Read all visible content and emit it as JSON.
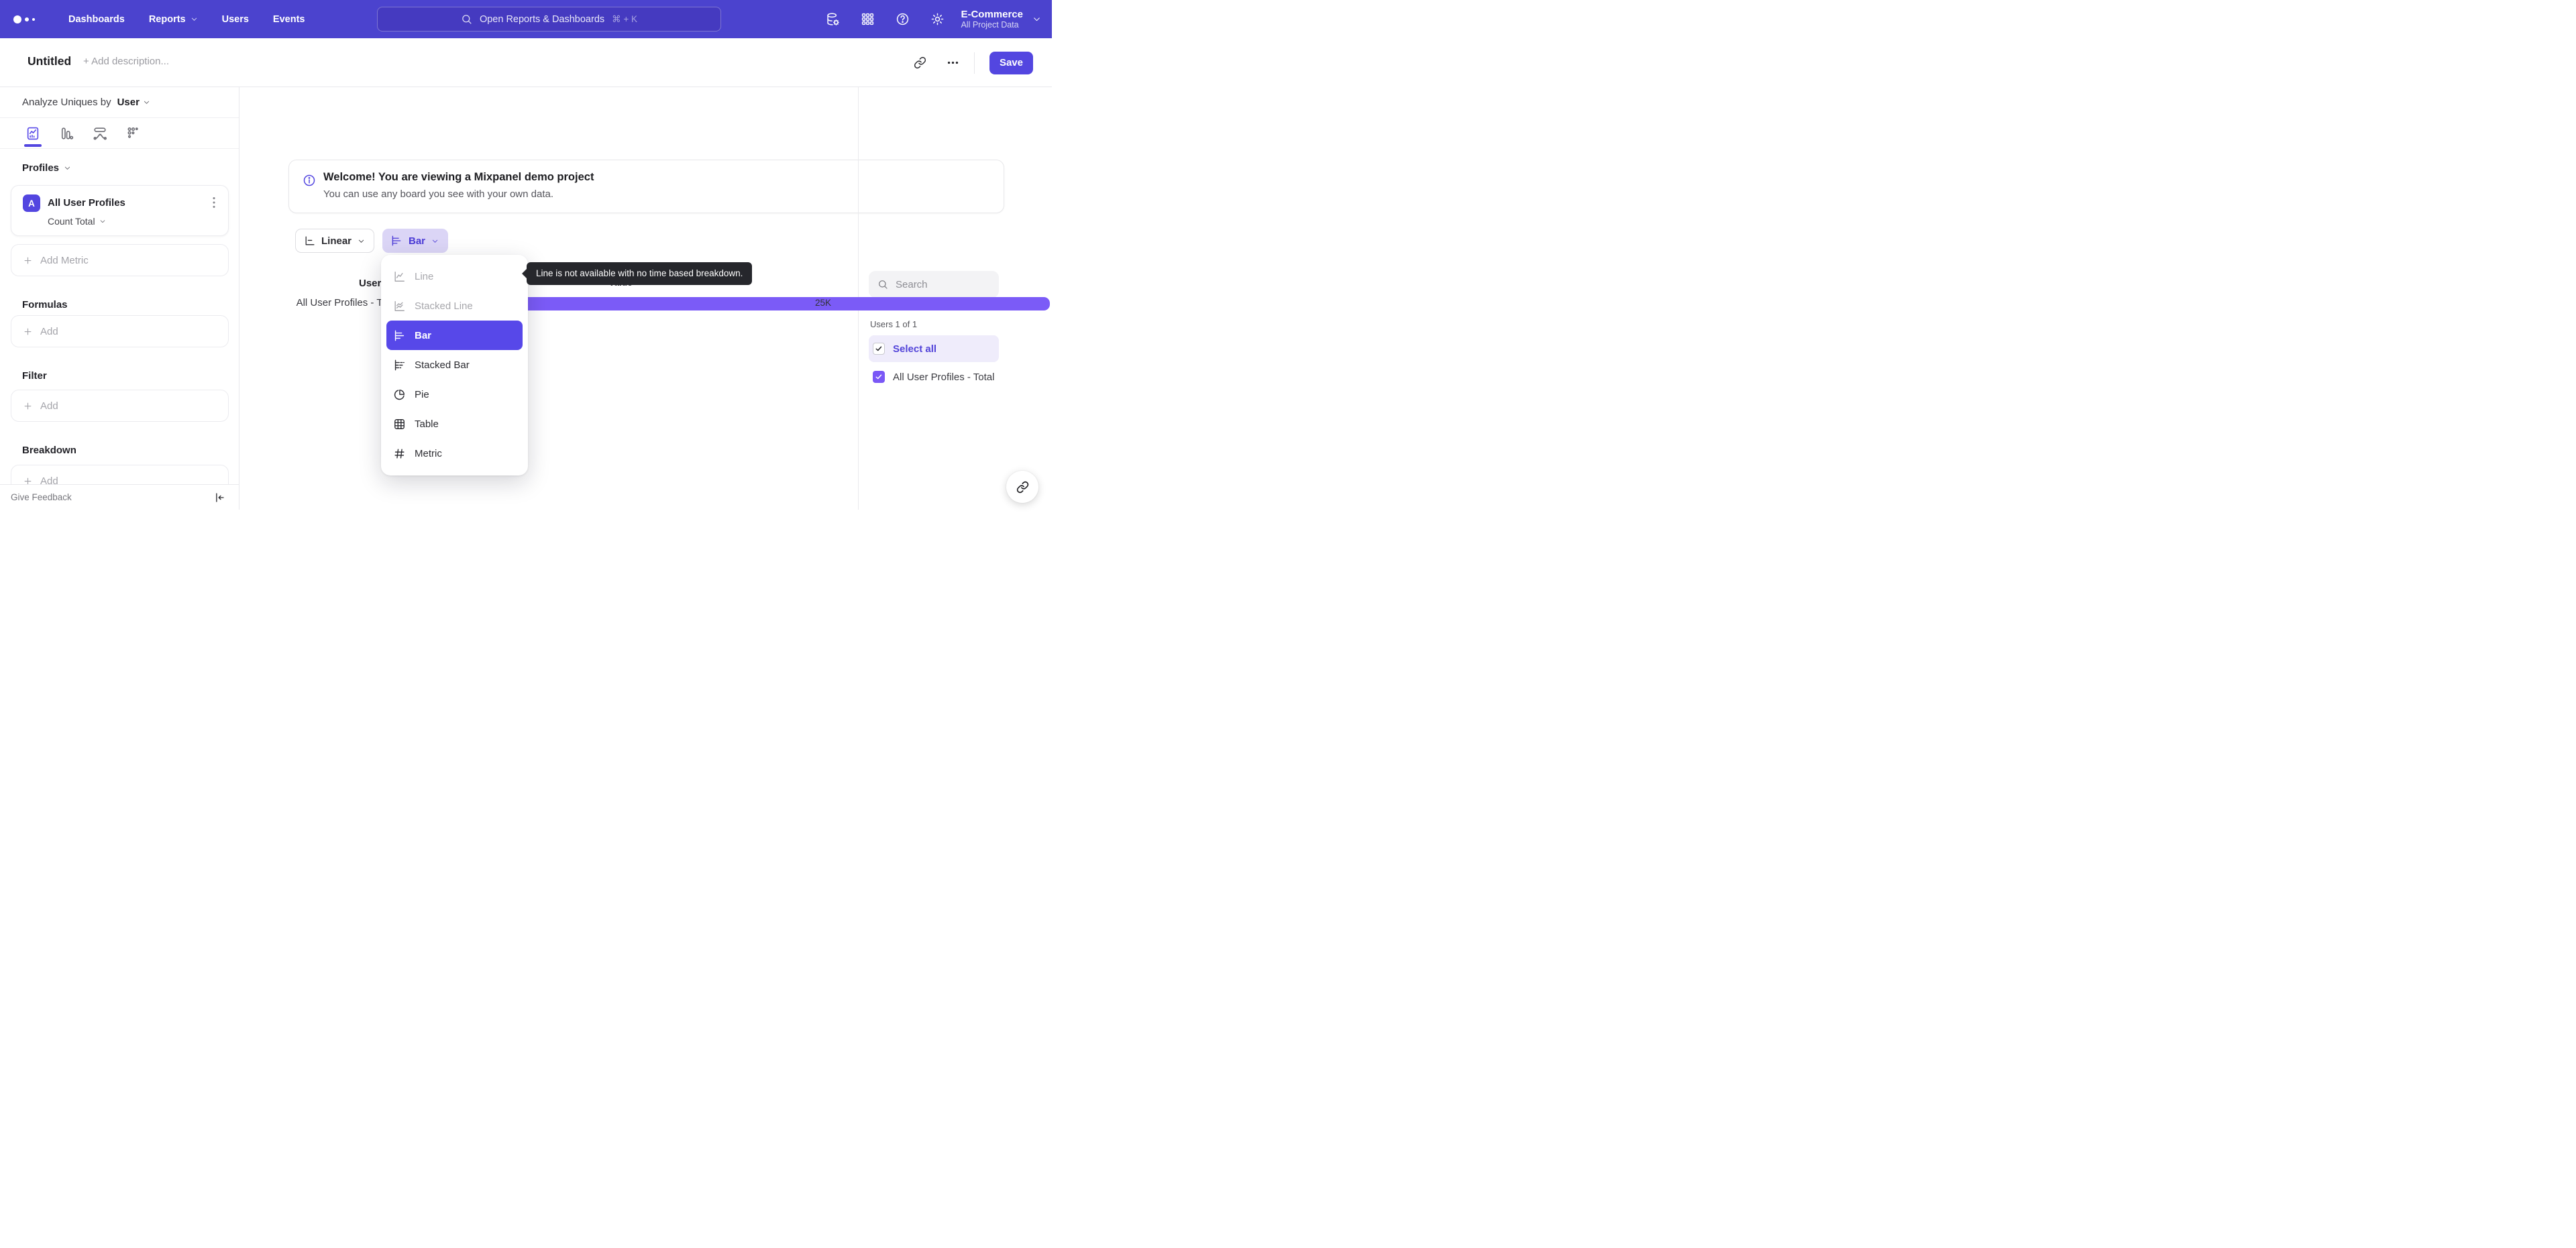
{
  "colors": {
    "nav_background": "#4B43CE",
    "accent": "#5346E0",
    "bar_fill": "#7B5BF7",
    "selected_menu_background": "#5748E9",
    "chart_type_button_background": "#DBD5F6",
    "select_all_background": "#EFECFB",
    "tooltip_background": "#26272C"
  },
  "topnav": {
    "items": [
      {
        "label": "Dashboards"
      },
      {
        "label": "Reports"
      },
      {
        "label": "Users"
      },
      {
        "label": "Events"
      }
    ],
    "search": {
      "placeholder": "Open Reports & Dashboards",
      "shortcut": "⌘ + K"
    },
    "project": {
      "name": "E-Commerce",
      "scope": "All Project Data"
    }
  },
  "header": {
    "title": "Untitled",
    "description_placeholder": "+ Add description...",
    "save_label": "Save"
  },
  "sidebar": {
    "analyze": {
      "prefix": "Analyze Uniques by",
      "selected": "User"
    },
    "profiles": {
      "title": "Profiles"
    },
    "metric": {
      "badge": "A",
      "name": "All User Profiles",
      "aggregation": "Count Total"
    },
    "add_metric_label": "Add Metric",
    "sections": {
      "formulas": {
        "title": "Formulas",
        "add_label": "Add"
      },
      "filter": {
        "title": "Filter",
        "add_label": "Add"
      },
      "breakdown": {
        "title": "Breakdown",
        "add_label": "Add"
      }
    },
    "footer": {
      "feedback_label": "Give Feedback"
    }
  },
  "banner": {
    "title": "Welcome! You are viewing a Mixpanel demo project",
    "subtitle": "You can use any board you see with your own data."
  },
  "controls": {
    "linear_label": "Linear",
    "chart_type_label": "Bar"
  },
  "dropdown": {
    "items": [
      {
        "label": "Line",
        "state": "disabled"
      },
      {
        "label": "Stacked Line",
        "state": "disabled"
      },
      {
        "label": "Bar",
        "state": "selected"
      },
      {
        "label": "Stacked Bar",
        "state": "normal"
      },
      {
        "label": "Pie",
        "state": "normal"
      },
      {
        "label": "Table",
        "state": "normal"
      },
      {
        "label": "Metric",
        "state": "normal"
      }
    ]
  },
  "tooltip": {
    "text": "Line is not available with no time based breakdown."
  },
  "chart_data": {
    "type": "bar",
    "title": "Users",
    "axis_label": "Value",
    "orientation": "horizontal",
    "categories": [
      "All User Profiles - Total"
    ],
    "values": [
      25000
    ],
    "value_labels": [
      "25K"
    ],
    "series": [
      {
        "name": "All User Profiles - Total",
        "values": [
          25000
        ]
      }
    ],
    "bar_color": "#7B5BF7"
  },
  "right_panel": {
    "search_placeholder": "Search",
    "count_label": "Users 1 of 1",
    "select_all_label": "Select all",
    "items": [
      {
        "label": "All User Profiles - Total",
        "checked": true
      }
    ]
  }
}
